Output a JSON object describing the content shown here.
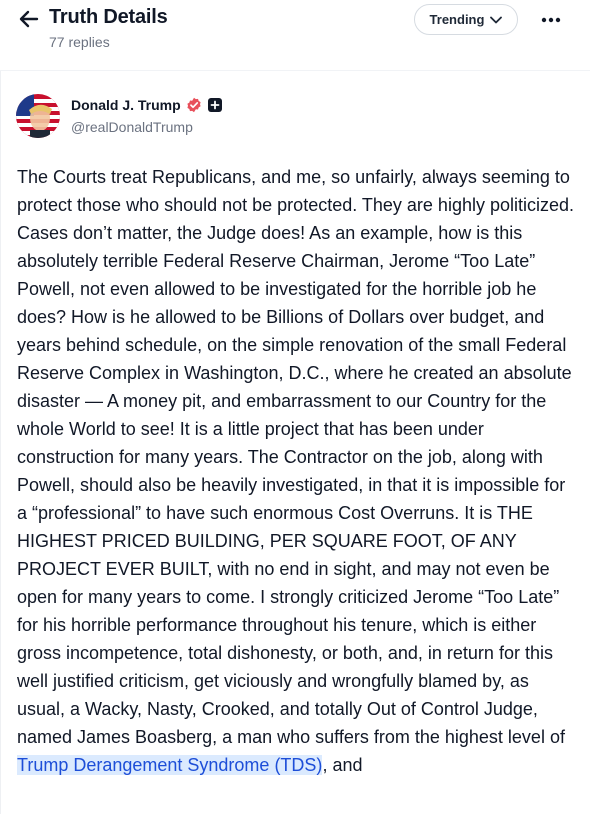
{
  "header": {
    "title": "Truth Details",
    "reply_count": "77 replies",
    "sort_label": "Trending",
    "back_icon": "arrow-left-icon",
    "more_icon": "more-horizontal-icon"
  },
  "post": {
    "author_name": "Donald J. Trump",
    "handle": "@realDonaldTrump",
    "verified_color": "#e8505b",
    "body_before": "The Courts treat Republicans, and me, so unfairly, always seeming to protect those who should not be protected. They are highly politicized. Cases don’t matter, the Judge does! As an example, how is this absolutely terrible Federal Reserve Chairman, Jerome “Too Late” Powell, not even allowed to be investigated for the horrible job he does? How is he allowed to be Billions of Dollars over budget, and years behind schedule, on the simple renovation of the small Federal Reserve Complex in Washington, D.C., where he created an absolute disaster — A money pit, and embarrassment to our Country for the whole World to see! It is a little project that has been under construction for many years. The Contractor on the job, along with Powell, should also be heavily investigated, in that it is impossible for a “professional” to have such enormous Cost Overruns. It is THE HIGHEST PRICED BUILDING, PER SQUARE FOOT, OF ANY PROJECT EVER BUILT, with no end in sight, and may not even be open for many years to come. I strongly criticized Jerome “Too Late” for his horrible performance throughout his tenure, which is either gross incompetence, total dishonesty, or both, and, in return for this well justified criticism, get viciously and wrongfully blamed by, as usual, a Wacky, Nasty, Crooked, and totally Out of Control Judge, named James Boasberg, a man who suffers from the highest level of ",
    "body_highlight": "Trump Derangement Syndrome (TDS)",
    "body_after": ", and"
  }
}
